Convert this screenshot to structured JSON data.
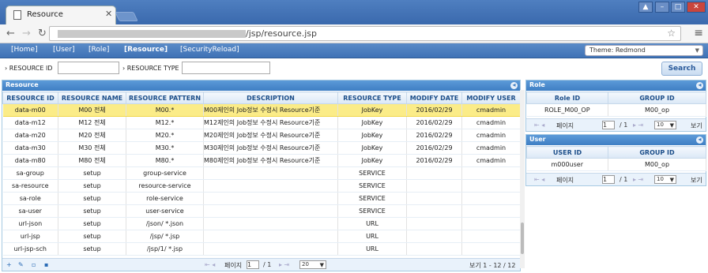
{
  "browser": {
    "tab_title": "Resource",
    "url_path": "/jsp/resource.jsp"
  },
  "menu": {
    "items": [
      "[Home]",
      "[User]",
      "[Role]",
      "[Resource]",
      "[SecurityReload]"
    ],
    "theme": "Theme: Redmond"
  },
  "search": {
    "resource_id_label": "RESOURCE ID",
    "resource_type_label": "RESOURCE TYPE",
    "button": "Search"
  },
  "resource": {
    "title": "Resource",
    "columns": [
      "RESOURCE ID",
      "RESOURCE NAME",
      "RESOURCE PATTERN",
      "DESCRIPTION",
      "RESOURCE TYPE",
      "MODIFY DATE",
      "MODIFY USER"
    ],
    "rows": [
      [
        "data-m00",
        "M00 전체",
        "M00.*",
        "M00제인의 Job정보 수정시 Resource기준",
        "JobKey",
        "2016/02/29",
        "cmadmin"
      ],
      [
        "data-m12",
        "M12 전체",
        "M12.*",
        "M12제인의 Job정보 수정시 Resource기준",
        "JobKey",
        "2016/02/29",
        "cmadmin"
      ],
      [
        "data-m20",
        "M20 전체",
        "M20.*",
        "M20제인의 Job정보 수정시 Resource기준",
        "JobKey",
        "2016/02/29",
        "cmadmin"
      ],
      [
        "data-m30",
        "M30 전체",
        "M30.*",
        "M30제인의 Job정보 수정시 Resource기준",
        "JobKey",
        "2016/02/29",
        "cmadmin"
      ],
      [
        "data-m80",
        "M80 전체",
        "M80.*",
        "M80제인의 Job정보 수정시 Resource기준",
        "JobKey",
        "2016/02/29",
        "cmadmin"
      ],
      [
        "sa-group",
        "setup",
        "group-service",
        "",
        "SERVICE",
        "",
        ""
      ],
      [
        "sa-resource",
        "setup",
        "resource-service",
        "",
        "SERVICE",
        "",
        ""
      ],
      [
        "sa-role",
        "setup",
        "role-service",
        "",
        "SERVICE",
        "",
        ""
      ],
      [
        "sa-user",
        "setup",
        "user-service",
        "",
        "SERVICE",
        "",
        ""
      ],
      [
        "url-json",
        "setup",
        "/json/ *.json",
        "",
        "URL",
        "",
        ""
      ],
      [
        "url-jsp",
        "setup",
        "/jsp/ *.jsp",
        "",
        "URL",
        "",
        ""
      ],
      [
        "url-jsp-sch",
        "setup",
        "/jsp/1/ *.jsp",
        "",
        "URL",
        "",
        ""
      ]
    ],
    "pager": {
      "page_label": "페이지",
      "page": "1",
      "of": "/ 1",
      "size": "20",
      "view": "보기 1 - 12 / 12"
    }
  },
  "role": {
    "title": "Role",
    "columns": [
      "Role ID",
      "GROUP ID"
    ],
    "rows": [
      [
        "ROLE_M00_OP",
        "M00_op"
      ]
    ],
    "pager": {
      "page_label": "페이지",
      "page": "1",
      "of": "/ 1",
      "size": "10",
      "view": "보기"
    }
  },
  "user": {
    "title": "User",
    "columns": [
      "USER ID",
      "GROUP ID"
    ],
    "rows": [
      [
        "m000user",
        "M00_op"
      ]
    ],
    "pager": {
      "page_label": "페이지",
      "page": "1",
      "of": "/ 1",
      "size": "10",
      "view": "보기"
    }
  }
}
